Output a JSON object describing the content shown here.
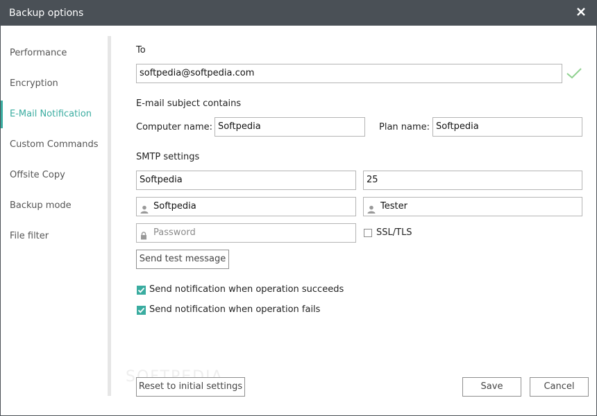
{
  "window": {
    "title": "Backup options"
  },
  "sidebar": {
    "items": [
      {
        "label": "Performance"
      },
      {
        "label": "Encryption"
      },
      {
        "label": "E-Mail Notification"
      },
      {
        "label": "Custom Commands"
      },
      {
        "label": "Offsite Copy"
      },
      {
        "label": "Backup mode"
      },
      {
        "label": "File filter"
      }
    ],
    "active": "E-Mail Notification"
  },
  "to": {
    "label": "To",
    "value": "softpedia@softpedia.com"
  },
  "subject": {
    "heading": "E-mail subject contains",
    "computer_label": "Computer name:",
    "computer_value": "Softpedia",
    "plan_label": "Plan name:",
    "plan_value": "Softpedia"
  },
  "smtp": {
    "heading": "SMTP settings",
    "server": "Softpedia",
    "port": "25",
    "username": "Softpedia",
    "sender": "Tester",
    "password_placeholder": "Password",
    "ssl_label": "SSL/TLS",
    "ssl_checked": false
  },
  "buttons": {
    "test": "Send test message",
    "reset": "Reset to initial settings",
    "save": "Save",
    "cancel": "Cancel"
  },
  "notifications": [
    {
      "label": "Send notification when operation succeeds",
      "checked": true
    },
    {
      "label": "Send notification when operation fails",
      "checked": true
    }
  ],
  "watermark": "SOFTPEDIA",
  "colors": {
    "titlebar": "#4a5056",
    "accent": "#3aaca0",
    "valid": "#8fd18f"
  }
}
